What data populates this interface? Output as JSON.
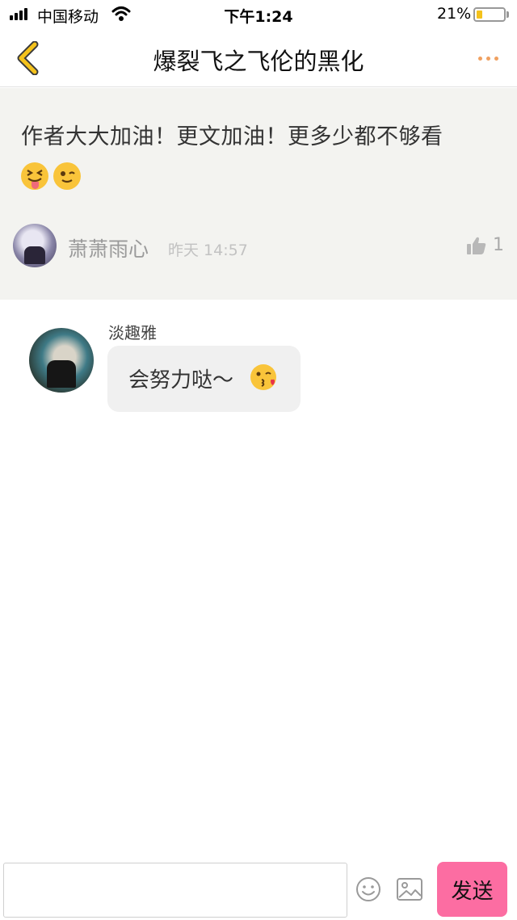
{
  "status_bar": {
    "carrier": "中国移动",
    "time": "下午1:24",
    "battery": "21%",
    "battery_level": 0.21
  },
  "header": {
    "title": "爆裂飞之飞伦的黑化"
  },
  "original_comment": {
    "text": "作者大大加油！更文加油！更多少都不够看",
    "emojis": [
      "squinting-tongue-emoji",
      "winking-emoji"
    ],
    "author": "萧萧雨心",
    "time": "昨天 14:57",
    "likes": "1"
  },
  "reply": {
    "author": "淡趣雅",
    "text": "会努力哒～",
    "emoji": "kissing-heart-emoji"
  },
  "input_bar": {
    "value": "",
    "placeholder": "",
    "send_label": "发送"
  },
  "colors": {
    "accent_send": "#fc6da2",
    "back_arrow": "#f4c21c",
    "more_dots": "#f0a060",
    "comment_bg": "#f3f3f0"
  }
}
